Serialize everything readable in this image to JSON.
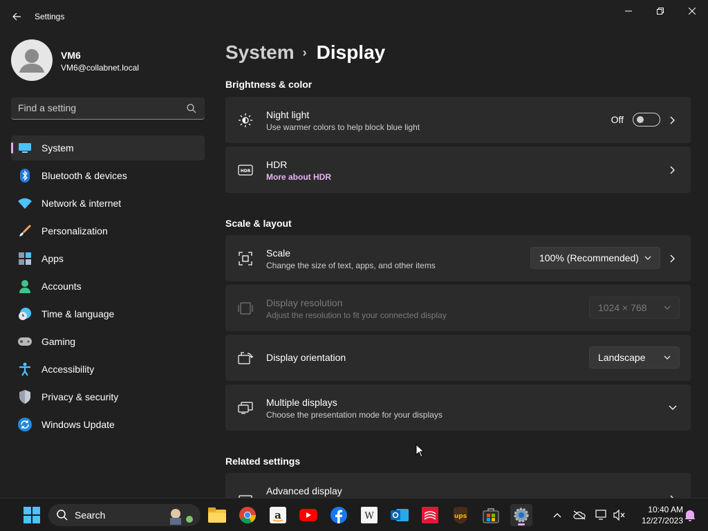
{
  "window": {
    "app_title": "Settings",
    "controls": [
      "minimize",
      "maximize",
      "close"
    ]
  },
  "profile": {
    "name": "VM6",
    "email": "VM6@collabnet.local"
  },
  "search": {
    "placeholder": "Find a setting"
  },
  "sidebar": {
    "items": [
      {
        "label": "System",
        "icon": "system-icon",
        "active": true
      },
      {
        "label": "Bluetooth & devices",
        "icon": "bluetooth-icon"
      },
      {
        "label": "Network & internet",
        "icon": "network-icon"
      },
      {
        "label": "Personalization",
        "icon": "brush-icon"
      },
      {
        "label": "Apps",
        "icon": "apps-icon"
      },
      {
        "label": "Accounts",
        "icon": "accounts-icon"
      },
      {
        "label": "Time & language",
        "icon": "time-language-icon"
      },
      {
        "label": "Gaming",
        "icon": "gamepad-icon"
      },
      {
        "label": "Accessibility",
        "icon": "accessibility-icon"
      },
      {
        "label": "Privacy & security",
        "icon": "shield-icon"
      },
      {
        "label": "Windows Update",
        "icon": "update-icon"
      }
    ]
  },
  "breadcrumb": {
    "parent": "System",
    "separator": "›",
    "current": "Display"
  },
  "sections": {
    "brightness": "Brightness & color",
    "scale_layout": "Scale & layout",
    "related": "Related settings"
  },
  "cards": {
    "night_light": {
      "title": "Night light",
      "subtitle": "Use warmer colors to help block blue light",
      "toggle_label": "Off",
      "toggle_on": false
    },
    "hdr": {
      "title": "HDR",
      "subtitle": "More about HDR"
    },
    "scale": {
      "title": "Scale",
      "subtitle": "Change the size of text, apps, and other items",
      "value": "100% (Recommended)"
    },
    "resolution": {
      "title": "Display resolution",
      "subtitle": "Adjust the resolution to fit your connected display",
      "value": "1024 × 768",
      "disabled": true
    },
    "orientation": {
      "title": "Display orientation",
      "value": "Landscape"
    },
    "multiple": {
      "title": "Multiple displays",
      "subtitle": "Choose the presentation mode for your displays"
    },
    "advanced": {
      "title": "Advanced display"
    }
  },
  "taskbar": {
    "search_label": "Search",
    "apps": [
      "start-icon",
      "file-explorer-icon",
      "chrome-icon",
      "amazon-icon",
      "youtube-icon",
      "facebook-icon",
      "wikipedia-icon",
      "outlook-icon",
      "bank-of-america-icon",
      "ups-icon",
      "microsoft-store-icon",
      "settings-icon"
    ],
    "time": "10:40 AM",
    "date": "12/27/2023"
  },
  "colors": {
    "accent": "#e9a8f5",
    "background": "#202020",
    "card": "#2b2b2b"
  }
}
